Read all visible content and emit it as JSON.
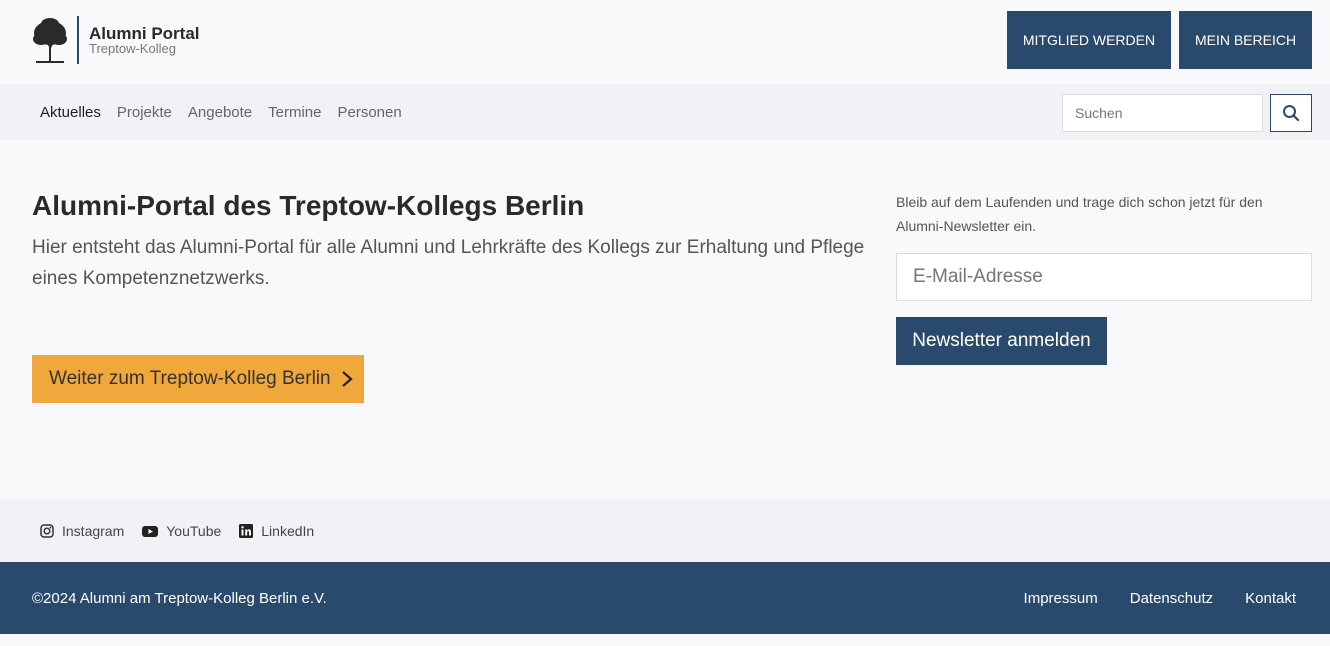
{
  "header": {
    "logo_title": "Alumni Portal",
    "logo_subtitle": "Treptow-Kolleg",
    "join_label": "MITGLIED WERDEN",
    "area_label": "MEIN BEREICH"
  },
  "nav": {
    "items": [
      {
        "label": "Aktuelles",
        "active": true
      },
      {
        "label": "Projekte"
      },
      {
        "label": "Angebote"
      },
      {
        "label": "Termine"
      },
      {
        "label": "Personen"
      }
    ],
    "search_placeholder": "Suchen",
    "search_icon": "search-icon"
  },
  "main": {
    "title": "Alumni-Portal des Treptow-Kollegs Berlin",
    "description": "Hier entsteht das Alumni-Portal für alle Alumni und Lehrkräfte des Kollegs zur Erhaltung und Pflege eines Kompetenznetzwerks.",
    "cta_label": "Weiter zum Treptow-Kolleg Berlin"
  },
  "newsletter": {
    "text": "Bleib auf dem Laufenden und trage dich schon jetzt für den Alumni-Newsletter ein.",
    "email_placeholder": "E-Mail-Adresse",
    "button_label": "Newsletter anmelden"
  },
  "social": {
    "items": [
      {
        "label": "Instagram",
        "icon": "instagram-icon"
      },
      {
        "label": "YouTube",
        "icon": "youtube-icon"
      },
      {
        "label": "LinkedIn",
        "icon": "linkedin-icon"
      }
    ]
  },
  "footer": {
    "copyright": "©2024 Alumni am Treptow-Kolleg Berlin e.V.",
    "links": [
      "Impressum",
      "Datenschutz",
      "Kontakt"
    ]
  },
  "colors": {
    "primary": "#294a6c",
    "accent": "#f0a83d",
    "background": "#f9f9fc",
    "band": "#f2f2f6"
  }
}
